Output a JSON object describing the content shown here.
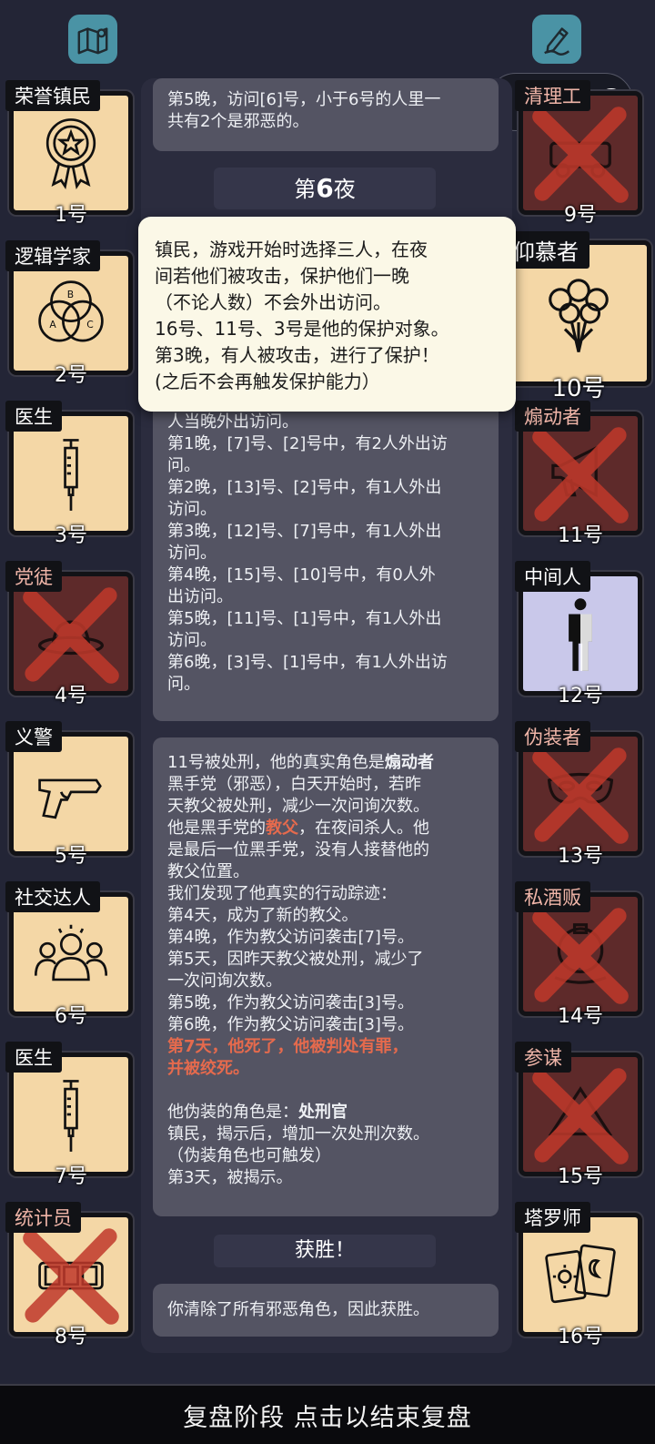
{
  "header": {
    "left_icon": "map-icon",
    "right_icon": "pen-icon"
  },
  "capsule": {
    "more_icon": "dots-icon",
    "close_icon": "target-icon"
  },
  "left_cards": [
    {
      "name": "荣誉镇民",
      "num": "1号",
      "icon": "medal",
      "dead": false
    },
    {
      "name": "逻辑学家",
      "num": "2号",
      "icon": "venn",
      "dead": false
    },
    {
      "name": "医生",
      "num": "3号",
      "icon": "syringe",
      "dead": false
    },
    {
      "name": "党徒",
      "num": "4号",
      "icon": "hat",
      "dead": true
    },
    {
      "name": "义警",
      "num": "5号",
      "icon": "gun",
      "dead": false
    },
    {
      "name": "社交达人",
      "num": "6号",
      "icon": "people",
      "dead": false
    },
    {
      "name": "医生",
      "num": "7号",
      "icon": "syringe",
      "dead": false
    },
    {
      "name": "统计员",
      "num": "8号",
      "icon": "counter",
      "dead": true
    }
  ],
  "right_cards": [
    {
      "name": "清理工",
      "num": "9号",
      "icon": "car",
      "dead": true
    },
    {
      "name": "仰慕者",
      "num": "10号",
      "icon": "roses",
      "dead": false
    },
    {
      "name": "煽动者",
      "num": "11号",
      "icon": "megaphone",
      "dead": true
    },
    {
      "name": "中间人",
      "num": "12号",
      "icon": "person",
      "dead": false
    },
    {
      "name": "伪装者",
      "num": "13号",
      "icon": "mask",
      "dead": true
    },
    {
      "name": "私酒贩",
      "num": "14号",
      "icon": "bottle",
      "dead": true
    },
    {
      "name": "参谋",
      "num": "15号",
      "icon": "board",
      "dead": true
    },
    {
      "name": "塔罗师",
      "num": "16号",
      "icon": "tarot",
      "dead": false
    }
  ],
  "panel_top": [
    "第5晚，访问[6]号，小于6号的人里一",
    "共有2个是邪恶的。"
  ],
  "night_banner": {
    "prefix": "第",
    "number": "6",
    "suffix": "夜"
  },
  "tooltip": [
    "镇民，游戏开始时选择三人，在夜",
    "间若他们被攻击，保护他们一晚",
    "（不论人数）不会外出访问。",
    "16号、11号、3号是他的保护对象。",
    "第3晚，有人被攻击，进行了保护！",
    "(之后不会再触发保护能力）"
  ],
  "panel_visits": [
    "人当晚外出访问。",
    "第1晚，[7]号、[2]号中，有2人外出访",
    "问。",
    "第2晚，[13]号、[2]号中，有1人外出",
    "访问。",
    "第3晚，[12]号、[7]号中，有1人外出",
    "访问。",
    "第4晚，[15]号、[10]号中，有0人外",
    "出访问。",
    "第5晚，[11]号、[1]号中，有1人外出",
    "访问。",
    "第6晚，[3]号、[1]号中，有1人外出访",
    "问。"
  ],
  "panel_exec": {
    "line1_prefix": "11号被处刑，他的真实角色是",
    "line1_role": "煽动者",
    "lines_a": [
      "黑手党（邪恶），白天开始时，若昨",
      "天教父被处刑，减少一次问询次数。"
    ],
    "line_godfather_prefix": "他是黑手党的",
    "line_godfather_role": "教父",
    "line_godfather_suffix": "，在夜间杀人。他",
    "lines_b": [
      "是最后一位黑手党，没有人接替他的",
      "教父位置。",
      "我们发现了他真实的行动踪迹：",
      "第4天，成为了新的教父。",
      "第4晚，作为教父访问袭击[7]号。",
      "第5天，因昨天教父被处刑，减少了",
      "一次问询次数。",
      "第5晚，作为教父访问袭击[3]号。",
      "第6晚，作为教父访问袭击[3]号。"
    ],
    "red_lines": [
      "第7天，他死了，他被判处有罪，",
      "并被绞死。"
    ],
    "disguise_prefix": "他伪装的角色是：",
    "disguise_role": "处刑官",
    "lines_c": [
      "镇民，揭示后，增加一次处刑次数。",
      "（伪装角色也可触发）",
      "第3天，被揭示。"
    ]
  },
  "win_banner": "获胜！",
  "panel_win": "你清除了所有邪恶角色，因此获胜。",
  "bottom_bar": "复盘阶段 点击以结束复盘",
  "colors": {
    "accent_red": "#e56a4d",
    "card_bg": "#f4d7a6",
    "dead_bg": "#5e2a2a",
    "ally_bg": "#c9c8ea"
  }
}
